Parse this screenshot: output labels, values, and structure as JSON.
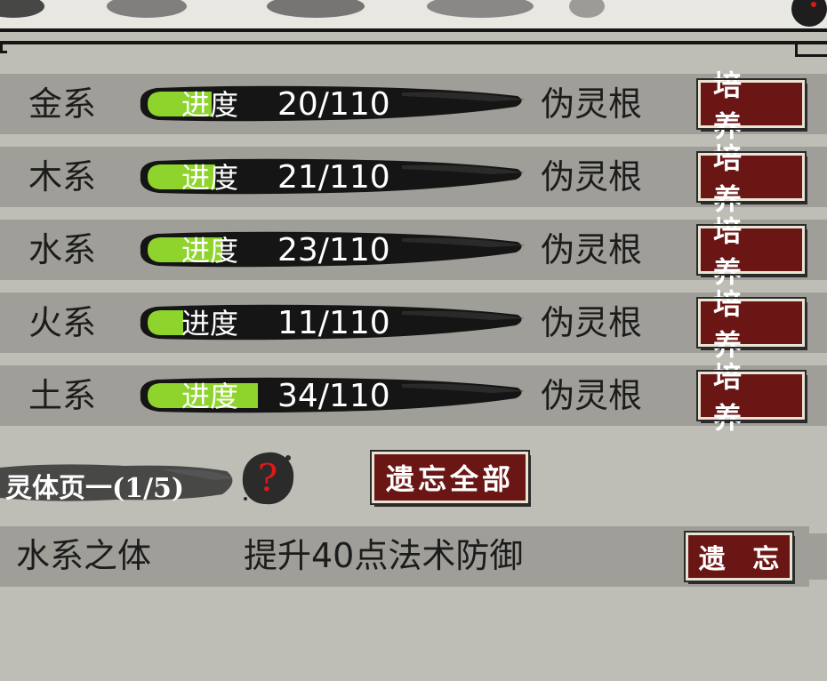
{
  "elements": {
    "row_label": "进度",
    "root_label": "伪灵根",
    "cultivate_button": "培 养",
    "rows": [
      {
        "name": "金系",
        "value": "20/110",
        "progress": 0.18
      },
      {
        "name": "木系",
        "value": "21/110",
        "progress": 0.19
      },
      {
        "name": "水系",
        "value": "23/110",
        "progress": 0.21
      },
      {
        "name": "火系",
        "value": "11/110",
        "progress": 0.1
      },
      {
        "name": "土系",
        "value": "34/110",
        "progress": 0.31
      }
    ]
  },
  "spirit_body": {
    "title": "灵体页一(1/5)",
    "help_icon": "?",
    "forget_all_button": "遗忘全部",
    "items": [
      {
        "name": "水系之体",
        "effect": "提升40点法术防御",
        "forget_button": "遗 忘"
      }
    ]
  },
  "colors": {
    "progress_green": "#8fd42c",
    "button_red": "#6a1615",
    "row_bg": "#9f9e98"
  }
}
